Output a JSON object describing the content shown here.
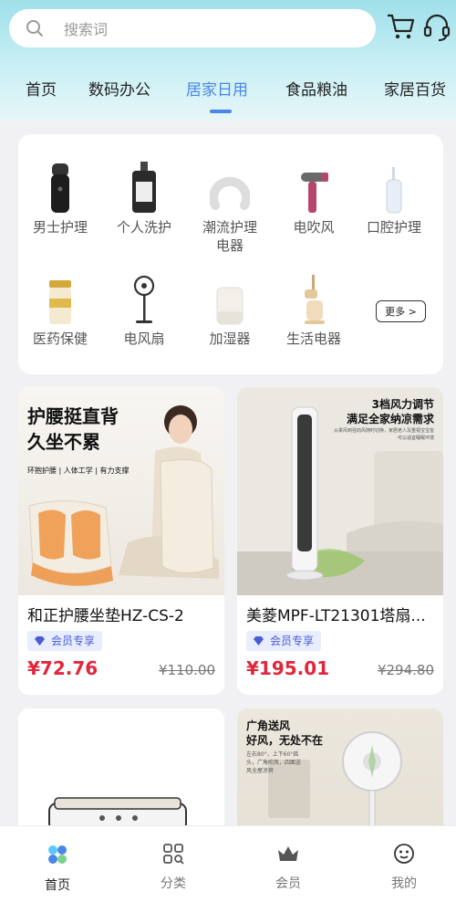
{
  "search": {
    "placeholder": "搜索词"
  },
  "tabs": [
    "首页",
    "数码办公",
    "居家日用",
    "食品粮油",
    "家居百货"
  ],
  "active_tab": "居家日用",
  "categories": [
    "男士护理",
    "个人洗护",
    "潮流护理\n电器",
    "电吹风",
    "口腔护理",
    "医药保健",
    "电风扇",
    "加湿器",
    "生活电器"
  ],
  "more_label": "更多 >",
  "products": [
    {
      "name": "和正护腰坐垫HZ-CS-2",
      "badge": "会员专享",
      "price": "¥72.76",
      "original_price": "¥110.00",
      "ad_title": "护腰挺直背",
      "ad_title2": "久坐不累",
      "ad_tags": "环抱护腰 | 人体工学 | 有力支撑"
    },
    {
      "name": "美菱MPF-LT21301塔扇...",
      "badge": "会员专享",
      "price": "¥195.01",
      "original_price": "¥294.80",
      "ad_title": "3档风力调节",
      "ad_title2": "满足全家纳凉需求",
      "ad_note": "从柔风到强劲风随时切换，家居老人及重视宝宝皆可以适宜睡眠环境"
    },
    {
      "ad_title": "广角送风",
      "ad_title2": "好风，无处不在",
      "ad_note": "左右80°，上下60°摇头，广角吹风，四面送风全屋凉爽"
    }
  ],
  "bottom_nav": [
    "首页",
    "分类",
    "会员",
    "我的"
  ],
  "colors": {
    "accent": "#4a86e8",
    "price": "#e0283c",
    "badge_bg": "#e8eeff",
    "header_top": "#9fe0ea"
  },
  "icons": [
    "search-icon",
    "cart-icon",
    "headset-icon",
    "home-icon",
    "category-icon",
    "crown-icon",
    "profile-icon"
  ]
}
